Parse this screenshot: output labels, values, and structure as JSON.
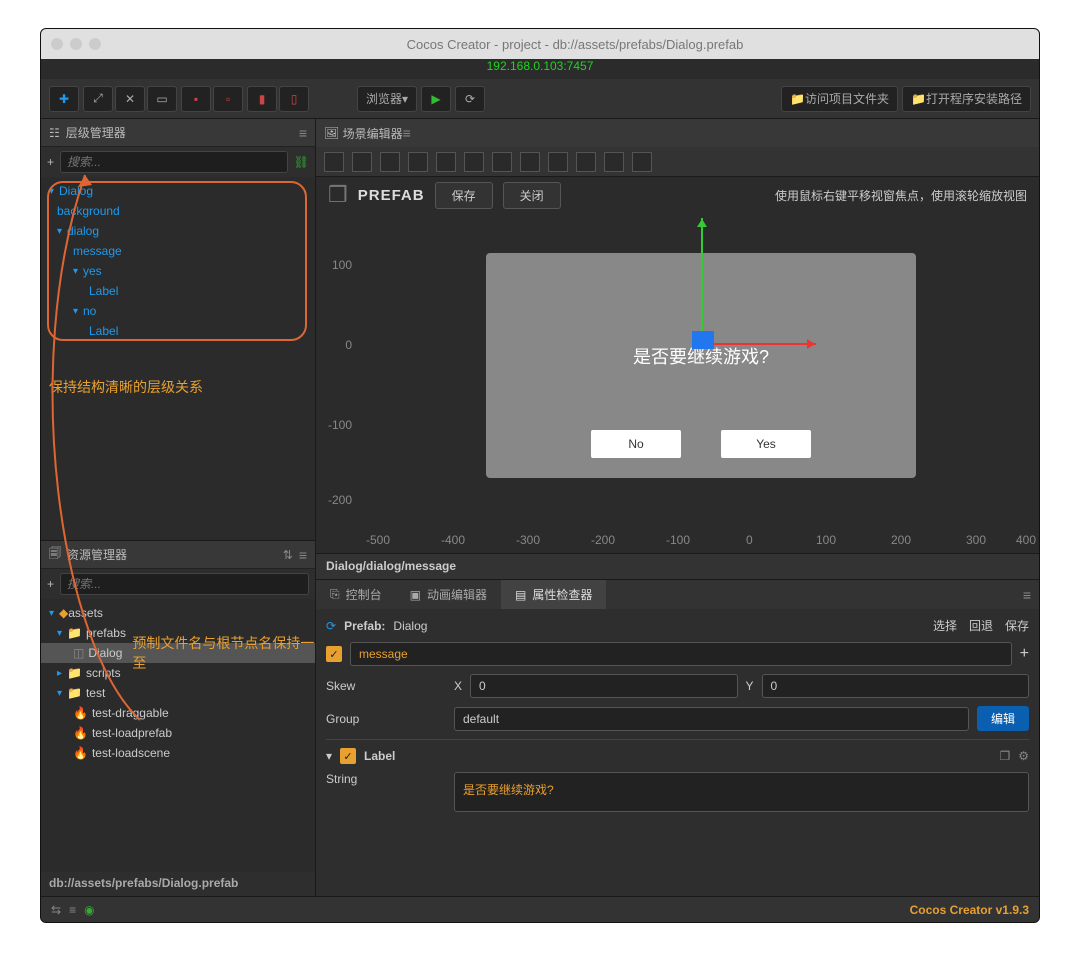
{
  "window": {
    "title": "Cocos Creator - project - db://assets/prefabs/Dialog.prefab",
    "ip": "192.168.0.103:7457"
  },
  "toolbar": {
    "browser": "浏览器",
    "open_folder": "访问项目文件夹",
    "open_install": "打开程序安装路径"
  },
  "hierarchy": {
    "title": "层级管理器",
    "search_placeholder": "搜索...",
    "nodes": {
      "n0": "Dialog",
      "n1": "background",
      "n2": "dialog",
      "n3": "message",
      "n4": "yes",
      "n5": "Label",
      "n6": "no",
      "n7": "Label"
    },
    "annotation": "保持结构清晰的层级关系"
  },
  "assets": {
    "title": "资源管理器",
    "search_placeholder": "搜索...",
    "root": "assets",
    "prefabs": "prefabs",
    "dialog": "Dialog",
    "scripts": "scripts",
    "test": "test",
    "t1": "test-draggable",
    "t2": "test-loadprefab",
    "t3": "test-loadscene",
    "annotation": "预制文件名与根节点名保持一至",
    "path": "db://assets/prefabs/Dialog.prefab"
  },
  "scene": {
    "title": "场景编辑器",
    "prefab_label": "PREFAB",
    "save": "保存",
    "close": "关闭",
    "hint": "使用鼠标右键平移视窗焦点，使用滚轮缩放视图",
    "dlg_msg": "是否要继续游戏?",
    "dlg_no": "No",
    "dlg_yes": "Yes",
    "breadcrumb": "Dialog/dialog/message",
    "v100": "100",
    "v0": "0",
    "vn100": "-100",
    "vn200": "-200",
    "hn500": "-500",
    "hn400": "-400",
    "hn300": "-300",
    "hn200": "-200",
    "hn100": "-100",
    "h0": "0",
    "h100": "100",
    "h200": "200",
    "h300": "300",
    "h400": "400"
  },
  "tabs": {
    "console": "控制台",
    "anim": "动画编辑器",
    "inspector": "属性检查器"
  },
  "inspector": {
    "prefab_label": "Prefab:",
    "prefab_name": "Dialog",
    "select": "选择",
    "revert": "回退",
    "save": "保存",
    "node_name": "message",
    "skew": "Skew",
    "x_label": "X",
    "x_val": "0",
    "y_label": "Y",
    "y_val": "0",
    "group": "Group",
    "group_val": "default",
    "edit": "编辑",
    "label_section": "Label",
    "string_label": "String",
    "string_val": "是否要继续游戏?"
  },
  "status": {
    "version": "Cocos Creator v1.9.3"
  }
}
